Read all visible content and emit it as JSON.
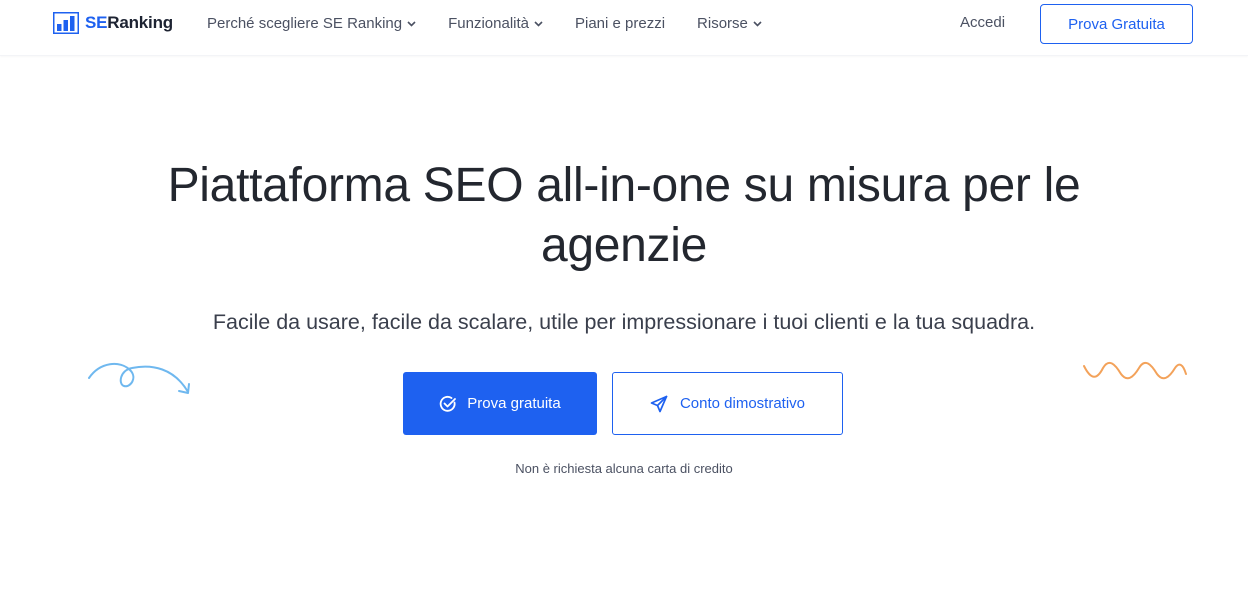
{
  "header": {
    "logo": {
      "se": "SE",
      "ranking": "Ranking"
    },
    "nav": [
      {
        "label": "Perché scegliere SE Ranking",
        "has_dropdown": true
      },
      {
        "label": "Funzionalità",
        "has_dropdown": true
      },
      {
        "label": "Piani e prezzi",
        "has_dropdown": false
      },
      {
        "label": "Risorse",
        "has_dropdown": true
      }
    ],
    "login_label": "Accedi",
    "cta_label": "Prova Gratuita"
  },
  "hero": {
    "title": "Piattaforma SEO all-in-one su misura per le agenzie",
    "subtitle": "Facile da usare, facile da scalare, utile per impressionare i tuoi clienti e la tua squadra.",
    "primary_button": {
      "label": "Prova gratuita",
      "icon": "check-circle-icon"
    },
    "secondary_button": {
      "label": "Conto dimostrativo",
      "icon": "paper-plane-icon"
    },
    "note": "Non è richiesta alcuna carta di credito"
  },
  "colors": {
    "accent": "#1e61f0",
    "text_dark": "#23272f",
    "text_muted": "#4b5162",
    "deco_left": "#6fb8ef",
    "deco_right": "#f3a25a"
  }
}
